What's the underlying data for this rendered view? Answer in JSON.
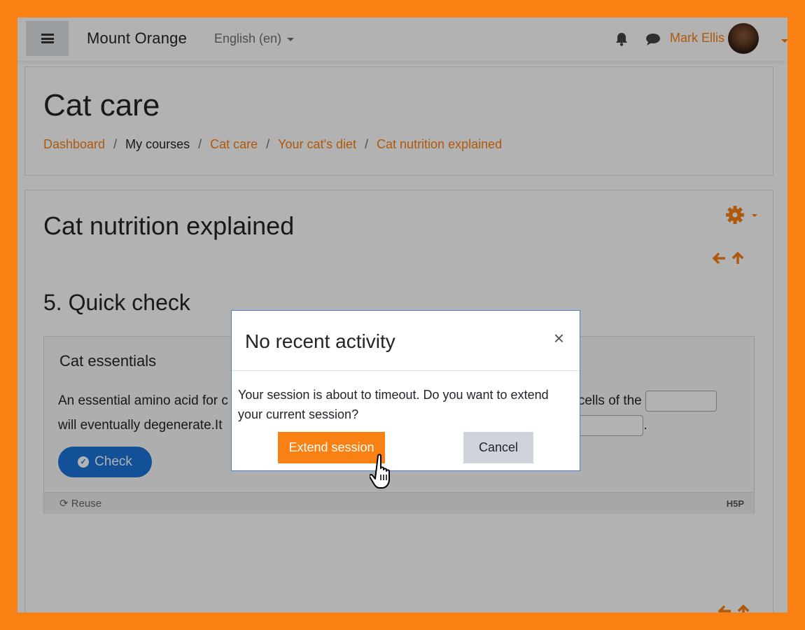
{
  "navbar": {
    "site_name": "Mount Orange",
    "language": "English (en)",
    "user_name": "Mark Ellis"
  },
  "header": {
    "course_title": "Cat care",
    "breadcrumb": [
      "Dashboard",
      "My courses",
      "Cat care",
      "Your cat's diet",
      "Cat nutrition explained"
    ]
  },
  "main": {
    "page_title": "Cat nutrition explained",
    "section_title": "5. Quick check",
    "h5p": {
      "title": "Cat essentials",
      "line1_start": "An essential amino acid for c",
      "line1_end": "cells of the",
      "line2_start": "will eventually degenerate.It",
      "line2_end": ".",
      "check_label": "Check",
      "reuse_label": "Reuse",
      "logo_text": "H5P"
    }
  },
  "modal": {
    "title": "No recent activity",
    "close_symbol": "×",
    "message": "Your session is about to timeout. Do you want to extend your current session?",
    "extend_label": "Extend session",
    "cancel_label": "Cancel"
  },
  "colors": {
    "brand": "#f98012",
    "check_button": "#1a73d9",
    "cancel_button": "#ced4da"
  }
}
